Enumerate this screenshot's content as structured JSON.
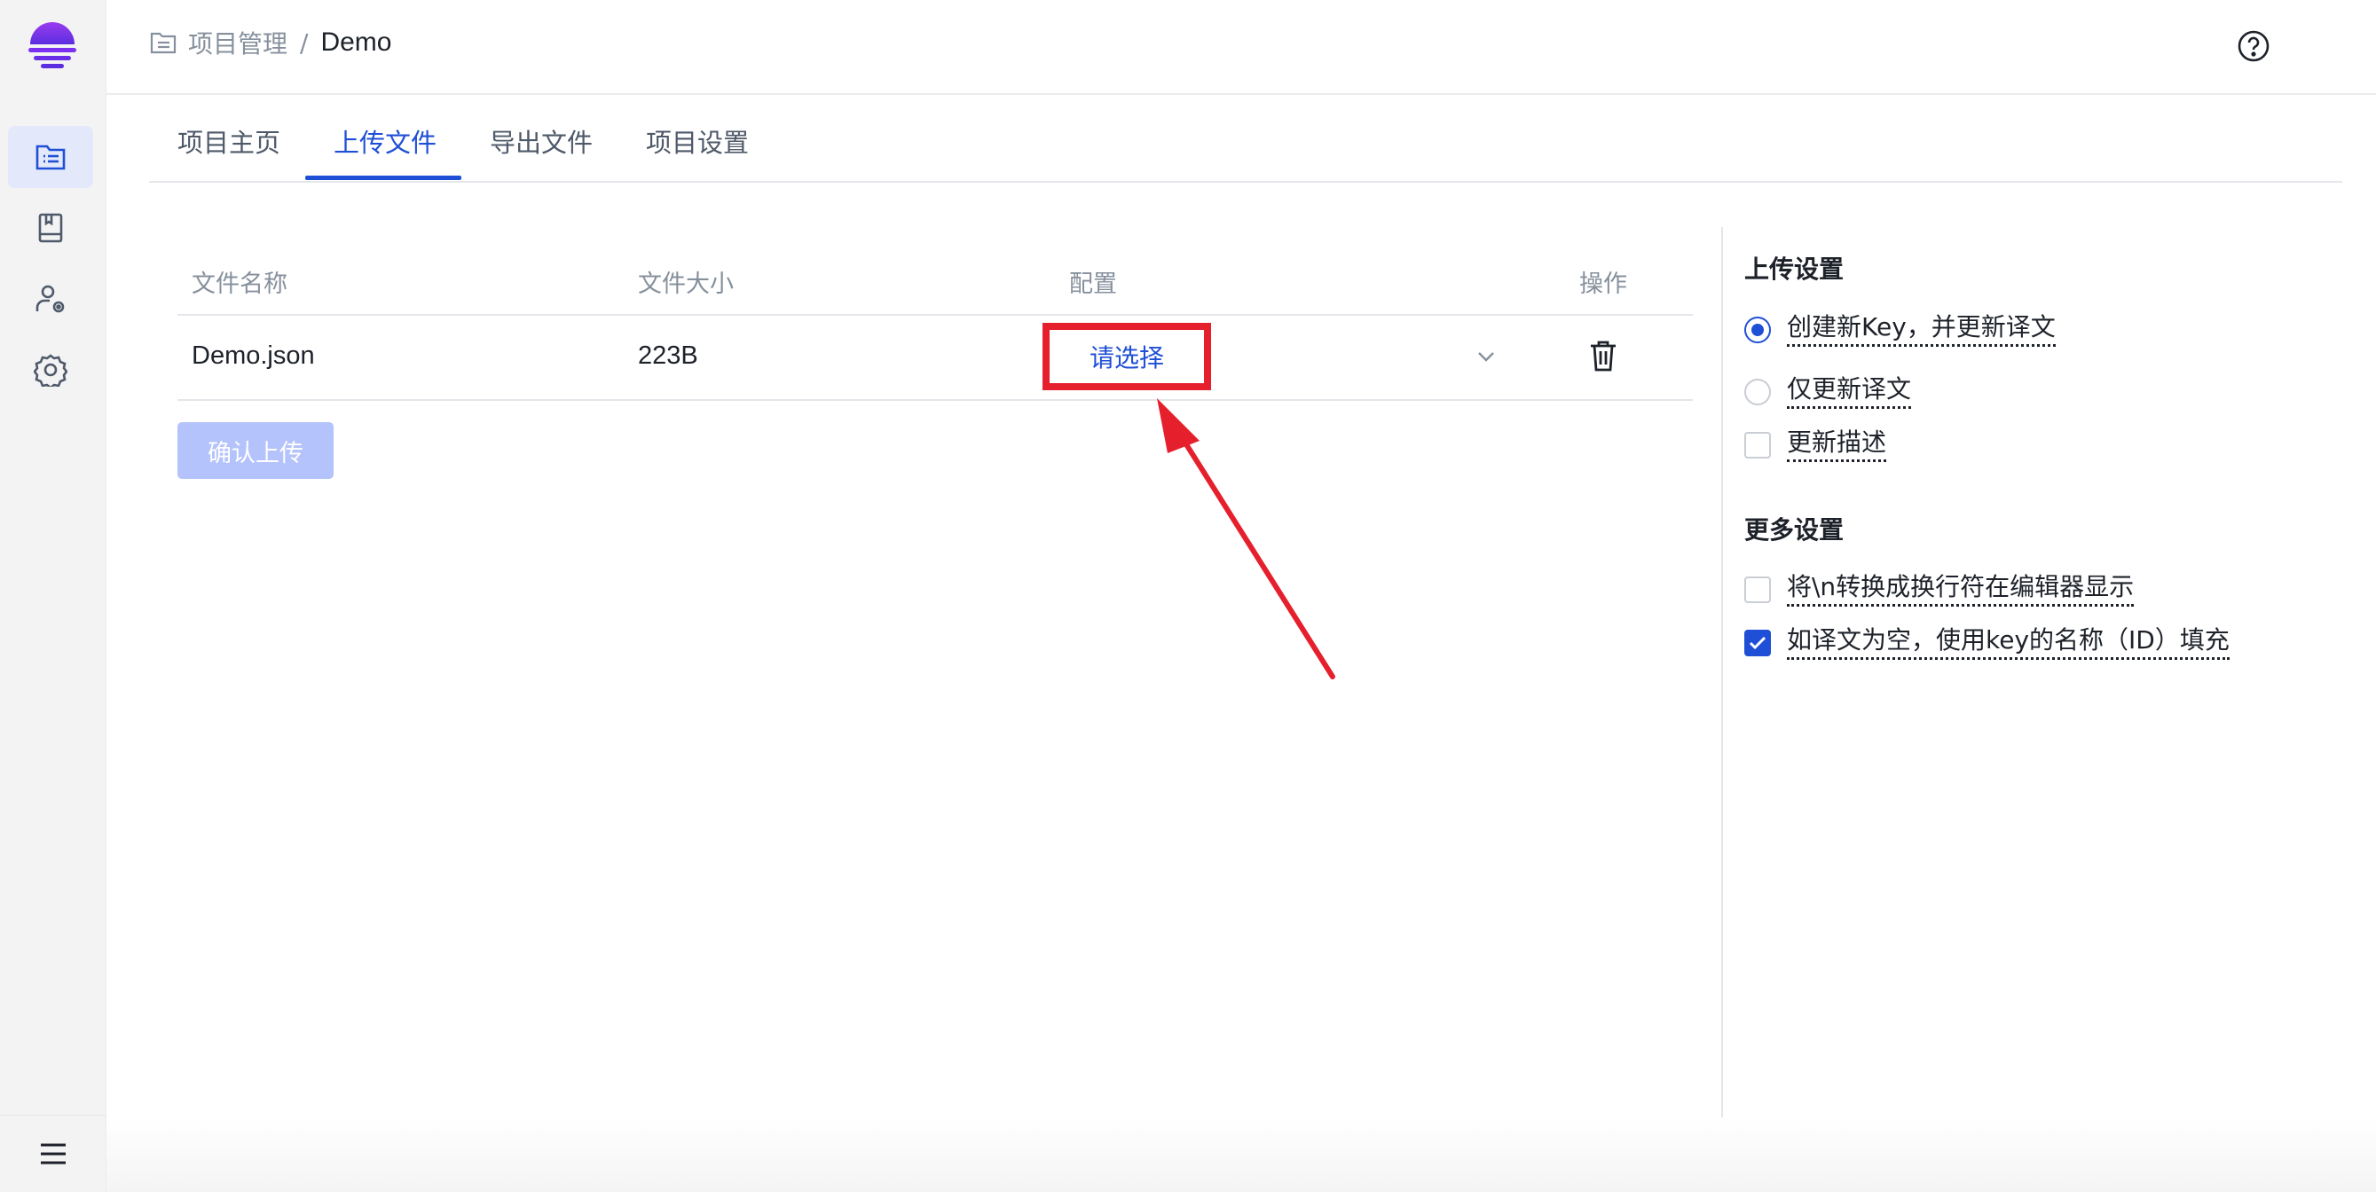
{
  "breadcrumb": {
    "parent": "项目管理",
    "separator": "/",
    "current": "Demo"
  },
  "tabs": [
    {
      "label": "项目主页"
    },
    {
      "label": "上传文件",
      "active": true
    },
    {
      "label": "导出文件"
    },
    {
      "label": "项目设置"
    }
  ],
  "table": {
    "headers": {
      "name": "文件名称",
      "size": "文件大小",
      "config": "配置",
      "actions": "操作"
    },
    "rows": [
      {
        "name": "Demo.json",
        "size": "223B",
        "config_placeholder": "请选择"
      }
    ]
  },
  "confirm_button": "确认上传",
  "upload_settings": {
    "title": "上传设置",
    "options": [
      {
        "label": "创建新Key，并更新译文",
        "type": "radio",
        "checked": true
      },
      {
        "label": "仅更新译文",
        "type": "radio",
        "checked": false
      },
      {
        "label": "更新描述",
        "type": "checkbox",
        "checked": false
      }
    ]
  },
  "more_settings": {
    "title": "更多设置",
    "options": [
      {
        "label": "将\\n转换成换行符在编辑器显示",
        "type": "checkbox",
        "checked": false
      },
      {
        "label": "如译文为空，使用key的名称（ID）填充",
        "type": "checkbox",
        "checked": true
      }
    ]
  },
  "icons": {
    "logo": "brand-logo-icon",
    "rail": [
      "project-list-icon",
      "book-icon",
      "user-settings-icon",
      "gear-icon",
      "menu-icon"
    ],
    "header": [
      "help-icon",
      "avatar"
    ],
    "row": [
      "chevron-down-icon",
      "trash-icon"
    ]
  },
  "colors": {
    "accent": "#1f4fd6",
    "highlight_box": "#e5202c",
    "confirm_disabled": "#b4c3fb",
    "logo_purple": "#7b2ff0"
  }
}
